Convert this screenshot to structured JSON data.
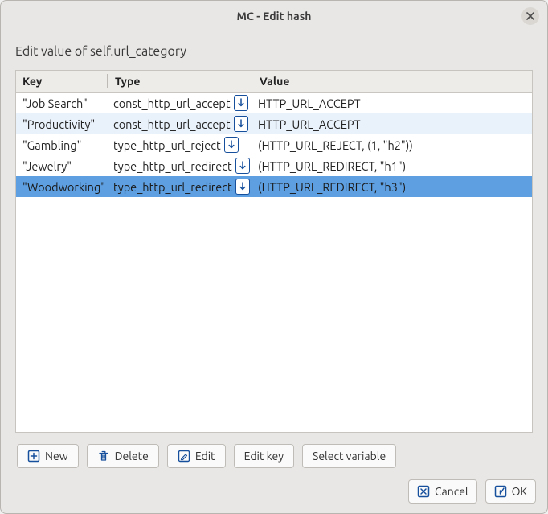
{
  "window": {
    "title": "MC - Edit hash"
  },
  "heading": "Edit value of self.url_category",
  "columns": {
    "key": "Key",
    "type": "Type",
    "value": "Value"
  },
  "rows": [
    {
      "key": "\"Job Search\"",
      "type": "const_http_url_accept",
      "value": "HTTP_URL_ACCEPT",
      "state": ""
    },
    {
      "key": "\"Productivity\"",
      "type": "const_http_url_accept",
      "value": "HTTP_URL_ACCEPT",
      "state": "alt"
    },
    {
      "key": "\"Gambling\"",
      "type": "type_http_url_reject",
      "value": "(HTTP_URL_REJECT, (1, \"h2\"))",
      "state": ""
    },
    {
      "key": "\"Jewelry\"",
      "type": "type_http_url_redirect",
      "value": "(HTTP_URL_REDIRECT, \"h1\")",
      "state": ""
    },
    {
      "key": "\"Woodworking\"",
      "type": "type_http_url_redirect",
      "value": "(HTTP_URL_REDIRECT, \"h3\")",
      "state": "sel"
    }
  ],
  "toolbar": {
    "new": "New",
    "delete": "Delete",
    "edit": "Edit",
    "edit_key": "Edit key",
    "select_variable": "Select variable"
  },
  "footer": {
    "cancel": "Cancel",
    "ok": "OK"
  }
}
